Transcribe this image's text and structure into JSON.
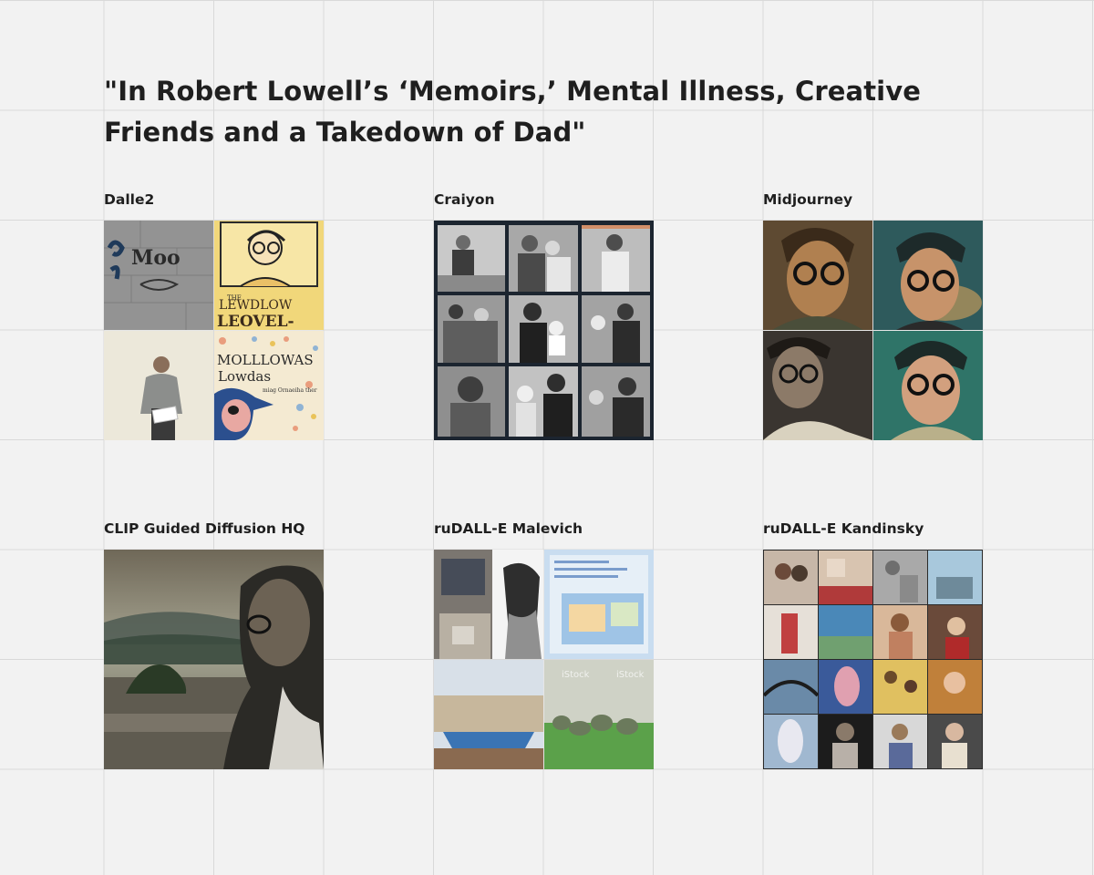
{
  "board": {
    "title": "\"In Robert Lowell’s ‘Memoirs,’ Mental Illness, Creative Friends and a Takedown of Dad\""
  },
  "cards": [
    {
      "label": "Dalle2",
      "image_texts": [
        "THE",
        "LEWDLOW",
        "LEOVEL-",
        "MOLLLOWAS",
        "Lowdas",
        "miag Ornaeiha ther"
      ]
    },
    {
      "label": "Craiyon"
    },
    {
      "label": "Midjourney"
    },
    {
      "label": "CLIP Guided Diffusion HQ"
    },
    {
      "label": "ruDALL-E Malevich",
      "image_texts": [
        "iStock",
        "iStock"
      ]
    },
    {
      "label": "ruDALL-E Kandinsky"
    }
  ]
}
